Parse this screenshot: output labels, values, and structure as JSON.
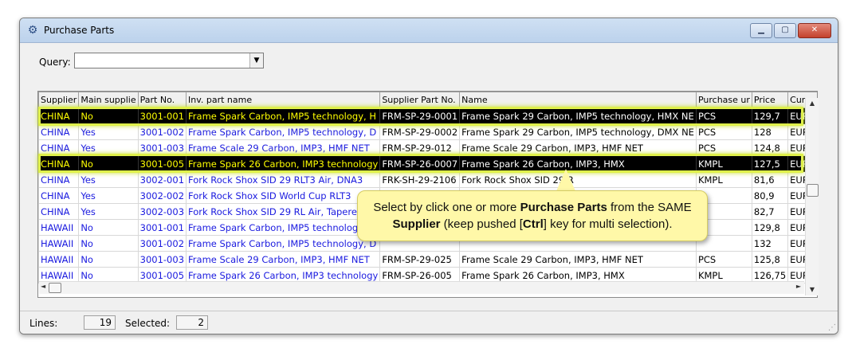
{
  "window": {
    "title": "Purchase Parts",
    "icon": "gear-icon"
  },
  "query": {
    "label": "Query:",
    "value": ""
  },
  "table": {
    "columns": [
      "Supplier",
      "Main supplie",
      "Part No.",
      "Inv. part name",
      "Supplier Part No.",
      "Name",
      "Purchase ur",
      "Price",
      "Currency"
    ],
    "rows": [
      {
        "selected": true,
        "cells": [
          "CHINA",
          "No",
          "3001-001",
          "Frame Spark Carbon, IMP5 technology, H",
          "FRM-SP-29-0001",
          "Frame Spark 29 Carbon, IMP5 technology, HMX NE",
          "PCS",
          "129,7",
          "EUR"
        ]
      },
      {
        "selected": false,
        "cells": [
          "CHINA",
          "Yes",
          "3001-002",
          "Frame Spark Carbon, IMP5 technology, D",
          "FRM-SP-29-0002",
          "Frame Spark 29 Carbon, IMP5 technology, DMX NE",
          "PCS",
          "128",
          "EUR"
        ]
      },
      {
        "selected": false,
        "cells": [
          "CHINA",
          "Yes",
          "3001-003",
          "Frame Scale 29 Carbon, IMP3, HMF NET",
          "FRM-SP-29-012",
          "Frame Scale 29 Carbon, IMP3, HMF NET",
          "PCS",
          "124,8",
          "EUR"
        ]
      },
      {
        "selected": true,
        "cells": [
          "CHINA",
          "No",
          "3001-005",
          "Frame Spark 26 Carbon, IMP3 technology",
          "FRM-SP-26-0007",
          "Frame Spark 26 Carbon, IMP3, HMX",
          "KMPL",
          "127,5",
          "EUR"
        ]
      },
      {
        "selected": false,
        "cells": [
          "CHINA",
          "Yes",
          "3002-001",
          "Fork Rock Shox SID 29 RLT3 Air, DNA3",
          "FRK-SH-29-2106",
          "Fork Rock Shox SID 29 R",
          "KMPL",
          "81,6",
          "EUR"
        ]
      },
      {
        "selected": false,
        "cells": [
          "CHINA",
          "Yes",
          "3002-002",
          "Fork Rock Shox SID World Cup RLT3",
          "",
          "",
          "",
          "80,9",
          "EUR"
        ]
      },
      {
        "selected": false,
        "cells": [
          "CHINA",
          "Yes",
          "3002-003",
          "Fork Rock Shox SID 29 RL Air, Tapere",
          "",
          "",
          "",
          "82,7",
          "EUR"
        ]
      },
      {
        "selected": false,
        "cells": [
          "HAWAII",
          "No",
          "3001-001",
          "Frame Spark Carbon, IMP5 technology,",
          "",
          "",
          "",
          "129,8",
          "EUR"
        ]
      },
      {
        "selected": false,
        "cells": [
          "HAWAII",
          "No",
          "3001-002",
          "Frame Spark Carbon, IMP5 technology, D",
          "",
          "",
          "",
          "132",
          "EUR"
        ]
      },
      {
        "selected": false,
        "cells": [
          "HAWAII",
          "No",
          "3001-003",
          "Frame Scale 29 Carbon, IMP3, HMF NET",
          "FRM-SP-29-025",
          "Frame Scale 29 Carbon, IMP3, HMF NET",
          "PCS",
          "125,8",
          "EUR"
        ]
      },
      {
        "selected": false,
        "cells": [
          "HAWAII",
          "No",
          "3001-005",
          "Frame Spark 26 Carbon, IMP3 technology",
          "FRM-SP-26-005",
          "Frame Spark 26 Carbon, IMP3, HMX",
          "KMPL",
          "126,75",
          "EUR"
        ]
      }
    ]
  },
  "status": {
    "lines_label": "Lines:",
    "lines_value": "19",
    "selected_label": "Selected:",
    "selected_value": "2"
  },
  "callout": {
    "part1": "Select by click one or more ",
    "bold1": "Purchase Parts",
    "part2": " from the SAME",
    "bold2": "Supplier",
    "part3": " (keep pushed [",
    "bold3": "Ctrl",
    "part4": "] key for multi selection)."
  },
  "colors": {
    "selection_bg": "#000000",
    "selection_text": "#ffff00",
    "highlight": "#dff04a",
    "link_text": "#1a1adf",
    "callout_bg": "#fff8a8"
  }
}
